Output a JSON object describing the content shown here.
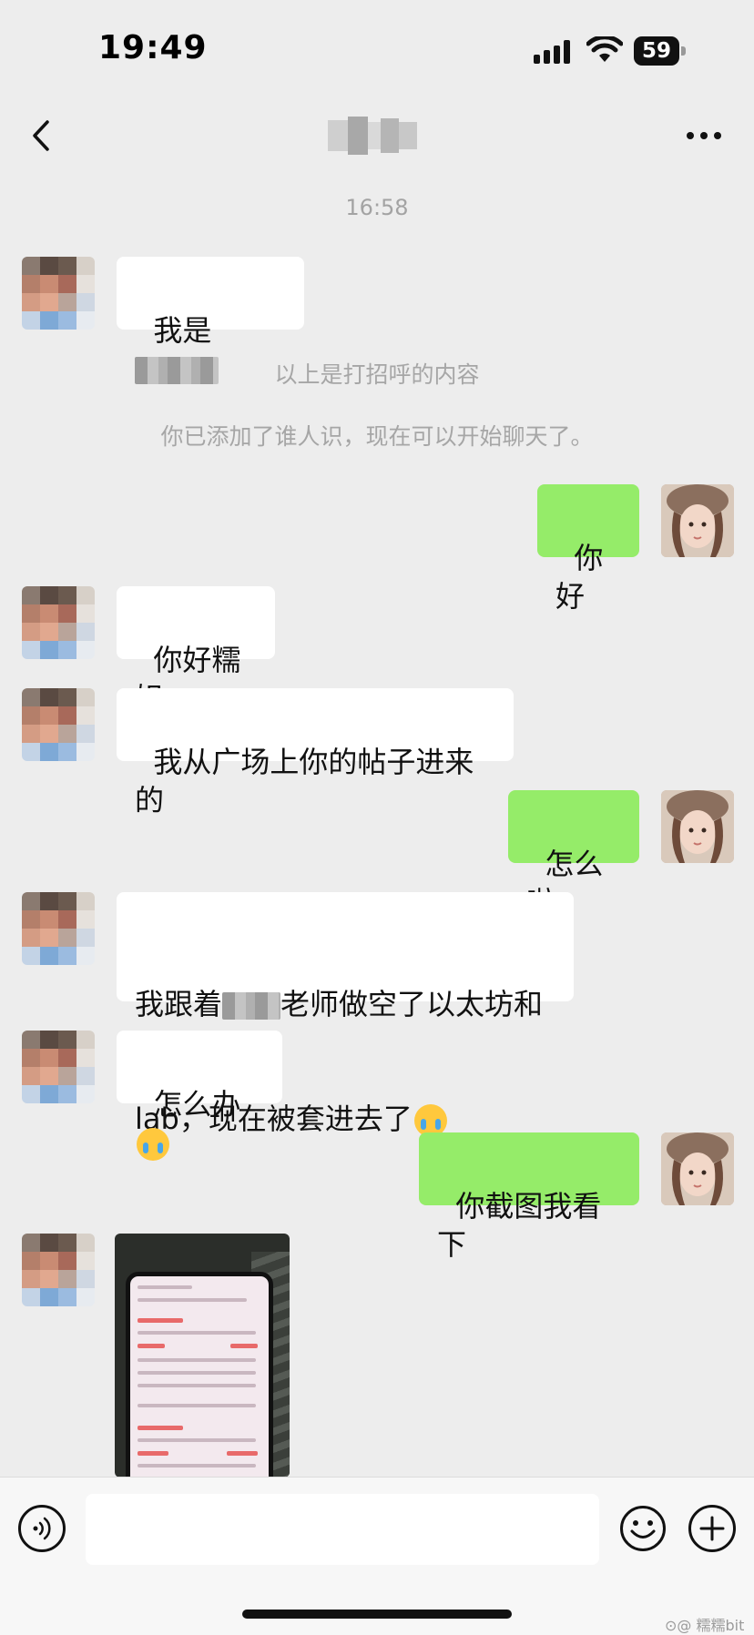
{
  "status_bar": {
    "time": "19:49",
    "battery_level": "59"
  },
  "chat": {
    "contact_name_hidden": true,
    "timestamp": "16:58",
    "system_messages": [
      "以上是打招呼的内容",
      "你已添加了谁人识，现在可以开始聊天了。"
    ],
    "messages": [
      {
        "side": "in",
        "text_before": "我是",
        "redacted": true,
        "text_after": ""
      },
      {
        "side": "out",
        "text": "你好"
      },
      {
        "side": "in",
        "text": "你好糯姐"
      },
      {
        "side": "in",
        "text": "我从广场上你的帖子进来的"
      },
      {
        "side": "out",
        "text": "怎么啦"
      },
      {
        "side": "in",
        "line1_before": "我跟着",
        "line1_after": "老师做空了以太坊和",
        "line2": "lab，现在被套进去了",
        "emoji": "loudly-crying-face"
      },
      {
        "side": "in",
        "text": "怎么办",
        "emoji": "loudly-crying-face"
      },
      {
        "side": "out",
        "text": "你截图我看下"
      },
      {
        "side": "in",
        "type": "image",
        "image_desc": "phone-screenshot-trading-app"
      }
    ]
  },
  "input": {
    "value": "",
    "placeholder": ""
  },
  "watermark": "⊙@ 糯糯bit",
  "colors": {
    "background": "#ededed",
    "incoming_bubble": "#ffffff",
    "outgoing_bubble": "#95ec69",
    "system_text": "#a6a6a6"
  }
}
